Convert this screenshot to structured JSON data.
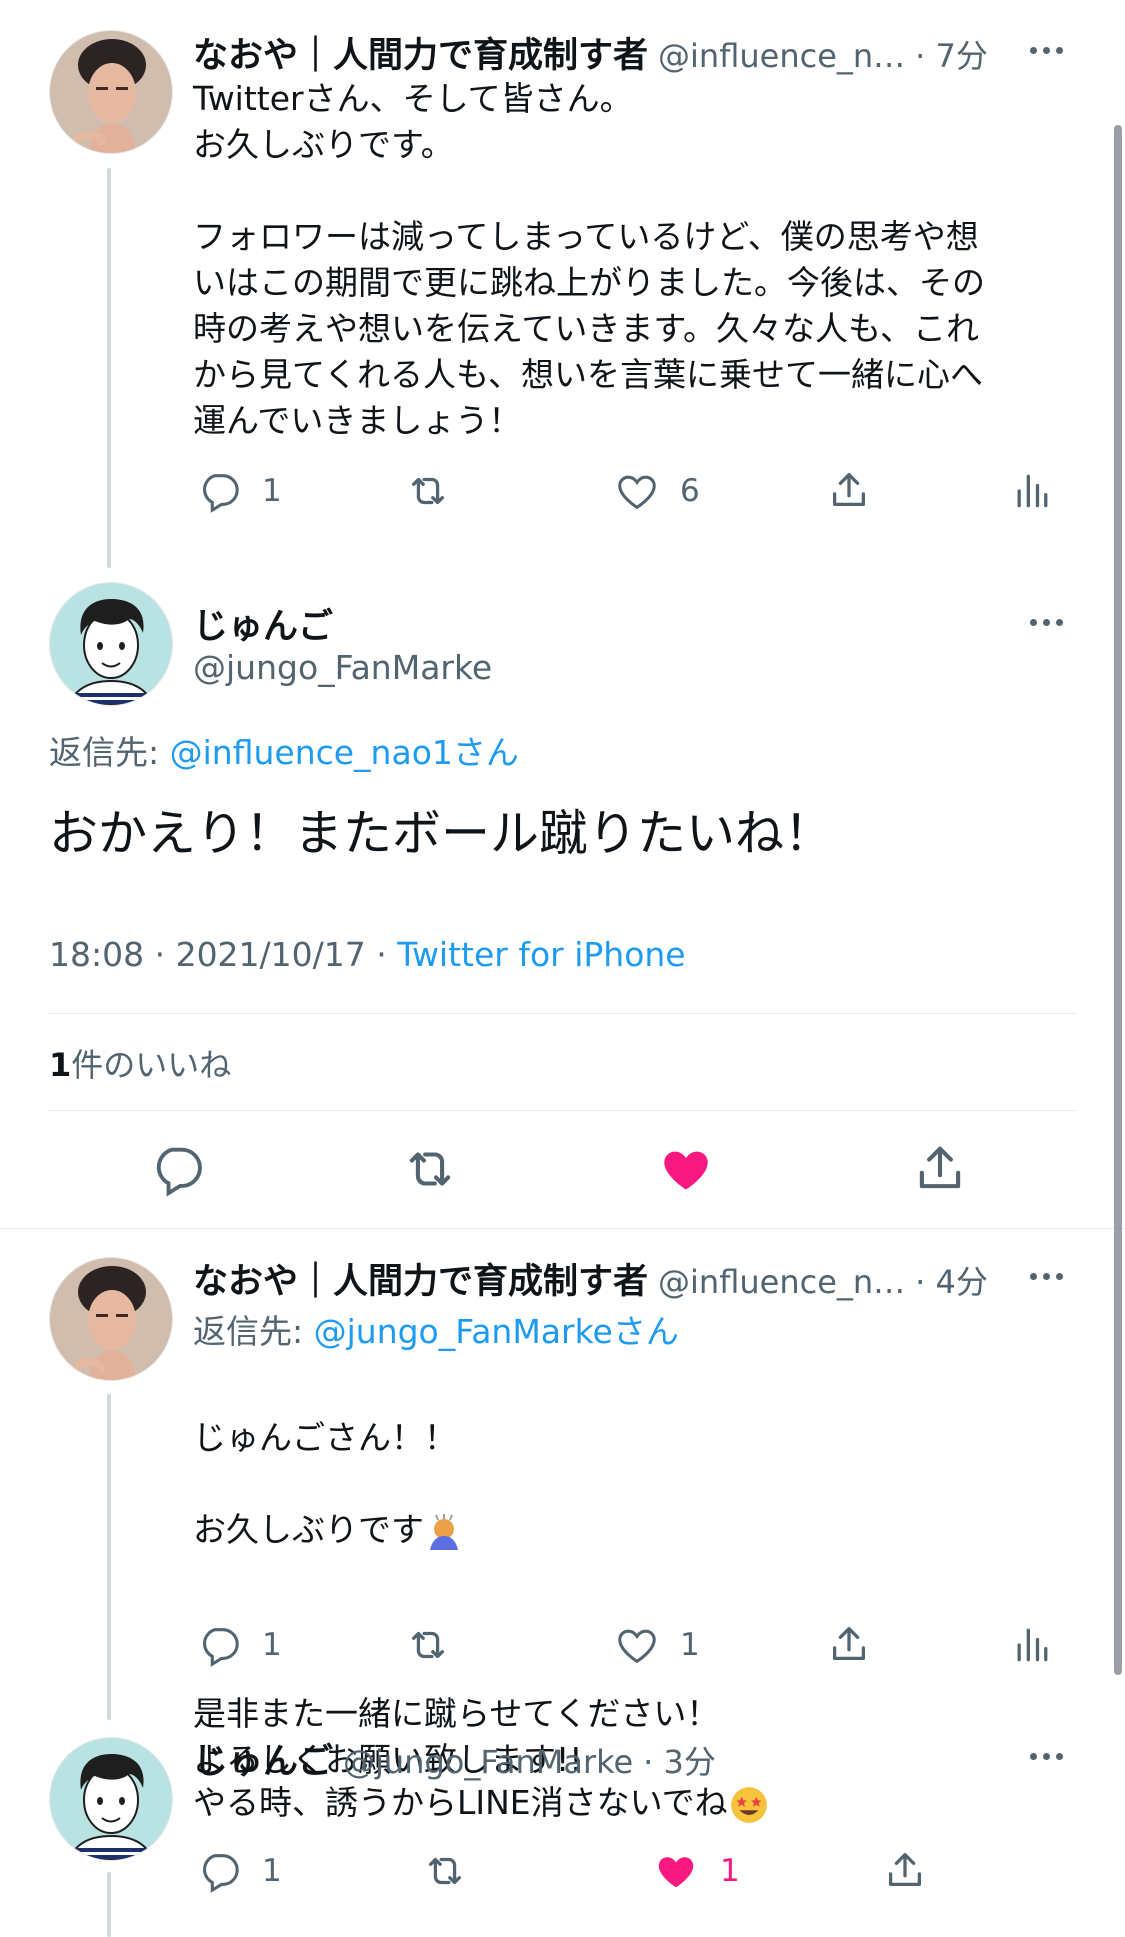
{
  "tweet1": {
    "name": "なおや｜人間力で育成制す者",
    "handle": "@influence_n…",
    "time": "· 7分",
    "text": "Twitterさん、そして皆さん。\nお久しぶりです。\n\nフォロワーは減ってしまっているけど、僕の思考や想\nいはこの期間で更に跳ね上がりました。今後は、その\n時の考えや想いを伝えていきます。久々な人も、これ\nから見てくれる人も、想いを言葉に乗せて一緒に心へ\n運んでいきましょう！",
    "reply_count": "1",
    "like_count": "6"
  },
  "focused": {
    "name": "じゅんご",
    "handle": "@jungo_FanMarke",
    "reply_to_prefix": "返信先: ",
    "reply_to_handle": "@influence_nao1さん",
    "text": "おかえり！またボール蹴りたいね！",
    "timestamp": "18:08 · 2021/10/17 · ",
    "source": "Twitter for iPhone",
    "likes_number": "1",
    "likes_label": "件のいいね",
    "liked_color": "#f91880"
  },
  "tweet2": {
    "name": "なおや｜人間力で育成制す者",
    "handle": "@influence_n…",
    "time": "· 4分",
    "reply_to_prefix": "返信先: ",
    "reply_to_handle": "@jungo_FanMarkeさん",
    "text_line1": "じゅんごさん！！",
    "text_line2": "お久しぶりです",
    "text_rest": "是非また一緒に蹴らせてください！\nよろしくお願い致します!!",
    "reply_count": "1",
    "like_count": "1"
  },
  "tweet3": {
    "name": "じゅんご",
    "handle": "@jungo_FanMarke",
    "time": "· 3分",
    "text": "やる時、誘うからLINE消さないでね",
    "reply_count": "1",
    "like_count": "1",
    "liked": true
  }
}
